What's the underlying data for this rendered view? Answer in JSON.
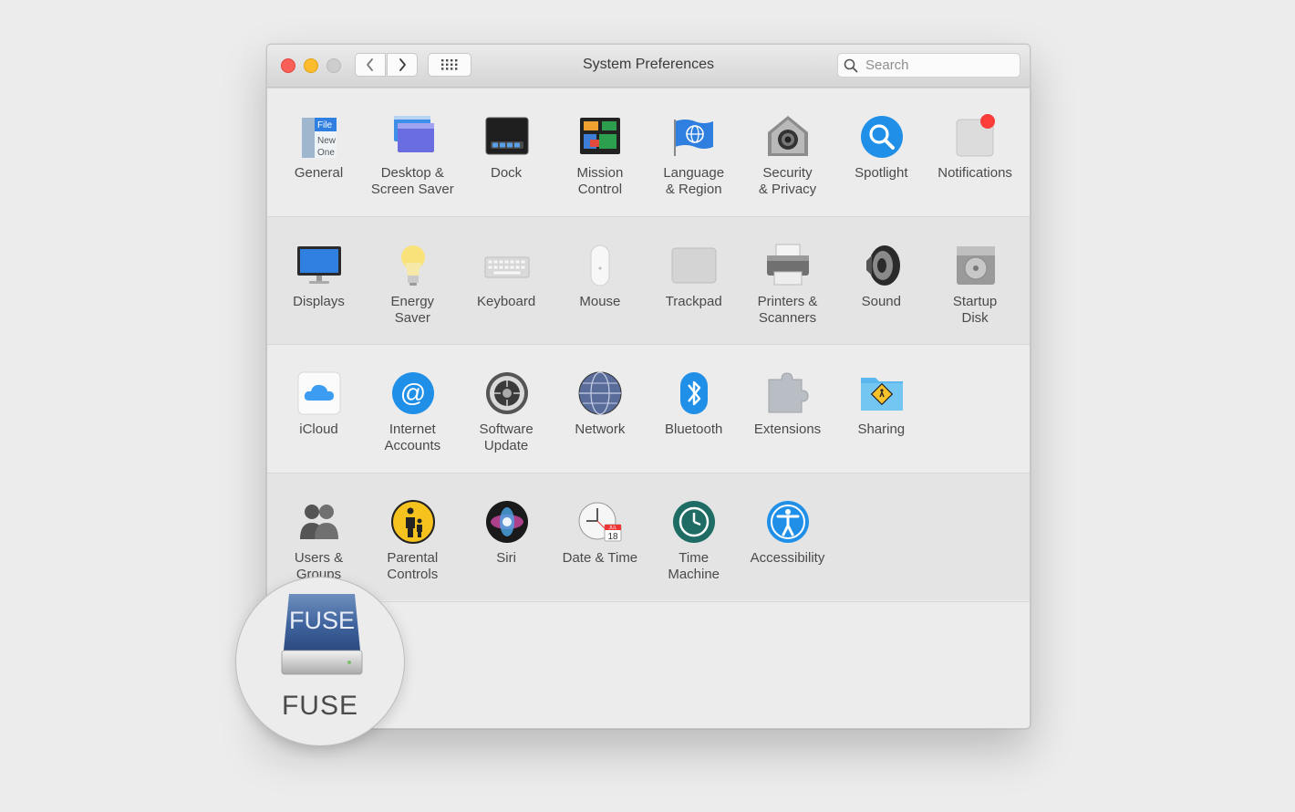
{
  "window": {
    "title": "System Preferences"
  },
  "search": {
    "placeholder": "Search"
  },
  "rows": [
    [
      {
        "label": "General",
        "icon": "general-icon"
      },
      {
        "label": "Desktop &\nScreen Saver",
        "icon": "desktop-screen-saver-icon"
      },
      {
        "label": "Dock",
        "icon": "dock-icon"
      },
      {
        "label": "Mission\nControl",
        "icon": "mission-control-icon"
      },
      {
        "label": "Language\n& Region",
        "icon": "language-region-icon"
      },
      {
        "label": "Security\n& Privacy",
        "icon": "security-privacy-icon"
      },
      {
        "label": "Spotlight",
        "icon": "spotlight-icon"
      },
      {
        "label": "Notifications",
        "icon": "notifications-icon"
      }
    ],
    [
      {
        "label": "Displays",
        "icon": "displays-icon"
      },
      {
        "label": "Energy\nSaver",
        "icon": "energy-saver-icon"
      },
      {
        "label": "Keyboard",
        "icon": "keyboard-icon"
      },
      {
        "label": "Mouse",
        "icon": "mouse-icon"
      },
      {
        "label": "Trackpad",
        "icon": "trackpad-icon"
      },
      {
        "label": "Printers &\nScanners",
        "icon": "printers-scanners-icon"
      },
      {
        "label": "Sound",
        "icon": "sound-icon"
      },
      {
        "label": "Startup\nDisk",
        "icon": "startup-disk-icon"
      }
    ],
    [
      {
        "label": "iCloud",
        "icon": "icloud-icon"
      },
      {
        "label": "Internet\nAccounts",
        "icon": "internet-accounts-icon"
      },
      {
        "label": "Software\nUpdate",
        "icon": "software-update-icon"
      },
      {
        "label": "Network",
        "icon": "network-icon"
      },
      {
        "label": "Bluetooth",
        "icon": "bluetooth-icon"
      },
      {
        "label": "Extensions",
        "icon": "extensions-icon"
      },
      {
        "label": "Sharing",
        "icon": "sharing-icon"
      }
    ],
    [
      {
        "label": "Users &\nGroups",
        "icon": "users-groups-icon"
      },
      {
        "label": "Parental\nControls",
        "icon": "parental-controls-icon"
      },
      {
        "label": "Siri",
        "icon": "siri-icon"
      },
      {
        "label": "Date & Time",
        "icon": "date-time-icon"
      },
      {
        "label": "Time\nMachine",
        "icon": "time-machine-icon"
      },
      {
        "label": "Accessibility",
        "icon": "accessibility-icon"
      }
    ]
  ],
  "general_icon_text": [
    "File",
    "New",
    "One"
  ],
  "date_icon_text": {
    "month": "JUL",
    "day": "18"
  },
  "fuse": {
    "label": "FUSE",
    "icon_text": "FUSE",
    "icon": "fuse-icon"
  }
}
